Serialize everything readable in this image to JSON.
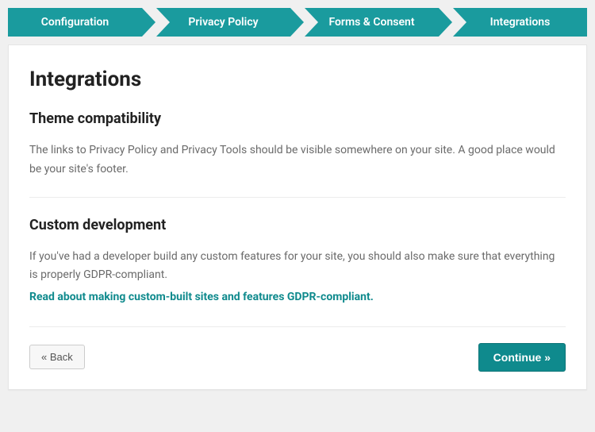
{
  "steps": {
    "items": [
      {
        "label": "Configuration"
      },
      {
        "label": "Privacy Policy"
      },
      {
        "label": "Forms & Consent"
      },
      {
        "label": "Integrations"
      }
    ]
  },
  "page": {
    "title": "Integrations"
  },
  "section_theme": {
    "title": "Theme compatibility",
    "body": "The links to Privacy Policy and Privacy Tools should be visible somewhere on your site. A good place would be your site's footer."
  },
  "section_custom": {
    "title": "Custom development",
    "body": "If you've had a developer build any custom features for your site, you should also make sure that everything is properly GDPR-compliant.",
    "link_text": "Read about making custom-built sites and features GDPR-compliant."
  },
  "footer": {
    "back_label": "« Back",
    "continue_label": "Continue »"
  }
}
